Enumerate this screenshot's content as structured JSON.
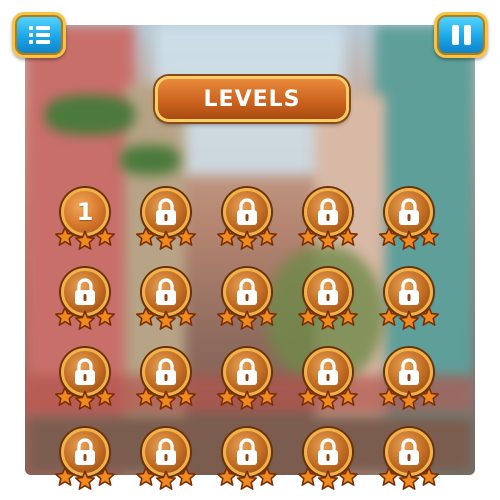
{
  "title": "LEVELS",
  "buttons": {
    "menu_icon": "menu-list-icon",
    "pause_icon": "pause-icon"
  },
  "colors": {
    "button_blue": "#1aa6e8",
    "banner_orange": "#c9611d",
    "medal_bronze": "#c06b22",
    "star_orange": "#f08a1c"
  },
  "levels": [
    {
      "number": "1",
      "locked": false,
      "stars_earned": 0
    },
    {
      "number": "",
      "locked": true,
      "stars_earned": 0
    },
    {
      "number": "",
      "locked": true,
      "stars_earned": 0
    },
    {
      "number": "",
      "locked": true,
      "stars_earned": 0
    },
    {
      "number": "",
      "locked": true,
      "stars_earned": 0
    },
    {
      "number": "",
      "locked": true,
      "stars_earned": 0
    },
    {
      "number": "",
      "locked": true,
      "stars_earned": 0
    },
    {
      "number": "",
      "locked": true,
      "stars_earned": 0
    },
    {
      "number": "",
      "locked": true,
      "stars_earned": 0
    },
    {
      "number": "",
      "locked": true,
      "stars_earned": 0
    },
    {
      "number": "",
      "locked": true,
      "stars_earned": 0
    },
    {
      "number": "",
      "locked": true,
      "stars_earned": 0
    },
    {
      "number": "",
      "locked": true,
      "stars_earned": 0
    },
    {
      "number": "",
      "locked": true,
      "stars_earned": 0
    },
    {
      "number": "",
      "locked": true,
      "stars_earned": 0
    },
    {
      "number": "",
      "locked": true,
      "stars_earned": 0
    },
    {
      "number": "",
      "locked": true,
      "stars_earned": 0
    },
    {
      "number": "",
      "locked": true,
      "stars_earned": 0
    },
    {
      "number": "",
      "locked": true,
      "stars_earned": 0
    },
    {
      "number": "",
      "locked": true,
      "stars_earned": 0
    }
  ]
}
